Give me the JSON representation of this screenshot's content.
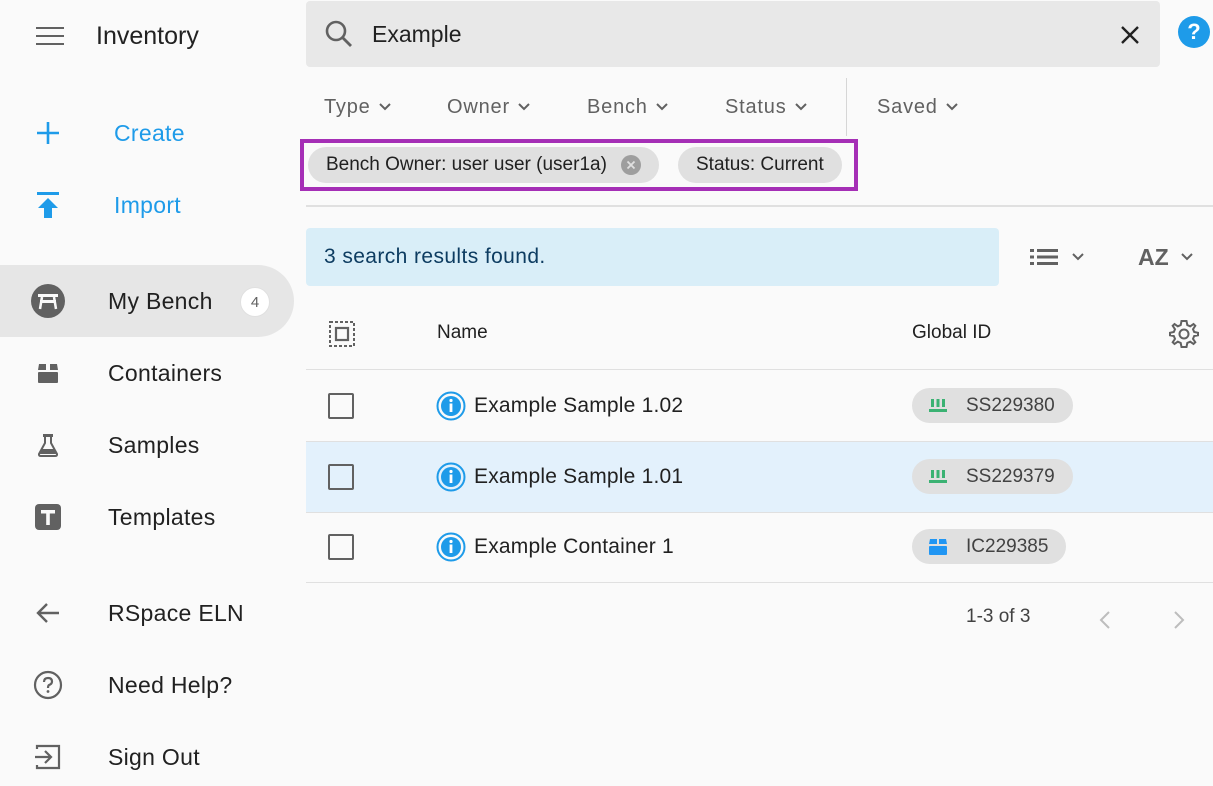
{
  "app": {
    "title": "Inventory"
  },
  "sidebar": {
    "create_label": "Create",
    "import_label": "Import",
    "items": [
      {
        "label": "My Bench",
        "count": "4",
        "icon": "bench-icon"
      },
      {
        "label": "Containers",
        "icon": "container-icon"
      },
      {
        "label": "Samples",
        "icon": "flask-icon"
      },
      {
        "label": "Templates",
        "icon": "template-icon"
      }
    ],
    "footer": [
      {
        "label": "RSpace ELN",
        "icon": "arrow-left-icon"
      },
      {
        "label": "Need Help?",
        "icon": "help-circle-icon"
      },
      {
        "label": "Sign Out",
        "icon": "sign-out-icon"
      }
    ]
  },
  "search": {
    "value": "Example"
  },
  "filters": {
    "type": "Type",
    "owner": "Owner",
    "bench": "Bench",
    "status": "Status",
    "saved": "Saved"
  },
  "chips": [
    {
      "label": "Bench Owner: user user (user1a)"
    },
    {
      "label": "Status: Current"
    }
  ],
  "results": {
    "summary": "3 search results found.",
    "sort_label": "AZ"
  },
  "table": {
    "columns": {
      "name": "Name",
      "global_id": "Global ID"
    },
    "rows": [
      {
        "name": "Example Sample 1.02",
        "global_id": "SS229380",
        "kind": "sample"
      },
      {
        "name": "Example Sample 1.01",
        "global_id": "SS229379",
        "kind": "sample"
      },
      {
        "name": "Example Container 1",
        "global_id": "IC229385",
        "kind": "container"
      }
    ]
  },
  "pagination": {
    "text": "1-3 of 3"
  },
  "colors": {
    "accent": "#1e9be9",
    "highlight_border": "#a52fb6",
    "sample_icon": "#3bb273",
    "container_icon": "#2196f3"
  }
}
